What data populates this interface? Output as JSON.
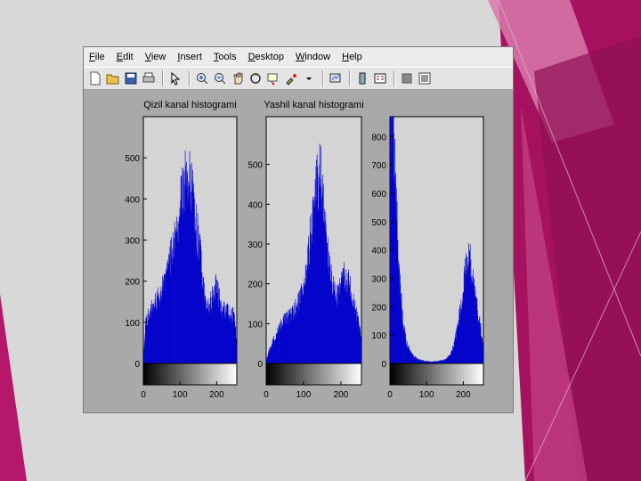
{
  "window": {
    "menu": [
      "File",
      "Edit",
      "View",
      "Insert",
      "Tools",
      "Desktop",
      "Window",
      "Help"
    ],
    "toolbar_icons": [
      "new-file-icon",
      "open-folder-icon",
      "save-icon",
      "print-icon",
      "sep",
      "pointer-icon",
      "sep",
      "zoom-in-icon",
      "zoom-out-icon",
      "pan-icon",
      "rotate-icon",
      "data-cursor-icon",
      "brush-icon",
      "dropdown-arrow-icon",
      "sep",
      "link-icon",
      "sep",
      "colorbar-icon",
      "legend-icon",
      "sep",
      "hide-tools-icon",
      "show-tools-icon"
    ]
  },
  "colors": {
    "bar": "#0000cc",
    "axes_bg": "#d4d4d4",
    "figure_bg": "#a9a9a9",
    "magenta": "#a6125f"
  },
  "chart_data": [
    {
      "type": "bar",
      "title": "Qizil kanal histogrami",
      "x_range": [
        0,
        255
      ],
      "ylim": [
        0,
        600
      ],
      "yticks": [
        0,
        100,
        200,
        300,
        400,
        500
      ],
      "xticks": [
        0,
        100,
        200
      ],
      "profile": [
        [
          0,
          15
        ],
        [
          5,
          100
        ],
        [
          15,
          120
        ],
        [
          30,
          145
        ],
        [
          45,
          170
        ],
        [
          60,
          200
        ],
        [
          75,
          260
        ],
        [
          90,
          320
        ],
        [
          100,
          380
        ],
        [
          110,
          440
        ],
        [
          118,
          480
        ],
        [
          125,
          450
        ],
        [
          135,
          400
        ],
        [
          145,
          330
        ],
        [
          155,
          270
        ],
        [
          165,
          180
        ],
        [
          175,
          140
        ],
        [
          185,
          155
        ],
        [
          195,
          185
        ],
        [
          200,
          205
        ],
        [
          205,
          170
        ],
        [
          215,
          125
        ],
        [
          225,
          135
        ],
        [
          240,
          120
        ],
        [
          250,
          110
        ],
        [
          255,
          45
        ]
      ]
    },
    {
      "type": "bar",
      "title": "Yashil kanal histogrami",
      "x_range": [
        0,
        255
      ],
      "ylim": [
        0,
        620
      ],
      "yticks": [
        0,
        100,
        200,
        300,
        400,
        500
      ],
      "xticks": [
        0,
        100,
        200
      ],
      "profile": [
        [
          0,
          10
        ],
        [
          10,
          40
        ],
        [
          25,
          70
        ],
        [
          40,
          100
        ],
        [
          55,
          115
        ],
        [
          70,
          130
        ],
        [
          85,
          150
        ],
        [
          100,
          190
        ],
        [
          110,
          250
        ],
        [
          120,
          340
        ],
        [
          128,
          420
        ],
        [
          138,
          460
        ],
        [
          145,
          480
        ],
        [
          150,
          450
        ],
        [
          160,
          380
        ],
        [
          168,
          250
        ],
        [
          178,
          190
        ],
        [
          188,
          170
        ],
        [
          198,
          195
        ],
        [
          205,
          240
        ],
        [
          212,
          215
        ],
        [
          222,
          200
        ],
        [
          235,
          150
        ],
        [
          248,
          115
        ],
        [
          255,
          60
        ]
      ]
    },
    {
      "type": "bar",
      "title": "",
      "x_range": [
        0,
        255
      ],
      "ylim": [
        0,
        870
      ],
      "yticks": [
        0,
        100,
        200,
        300,
        400,
        500,
        600,
        700,
        800
      ],
      "xticks": [
        0,
        100,
        200
      ],
      "profile": [
        [
          0,
          870
        ],
        [
          8,
          870
        ],
        [
          14,
          700
        ],
        [
          20,
          480
        ],
        [
          26,
          290
        ],
        [
          34,
          160
        ],
        [
          45,
          70
        ],
        [
          58,
          35
        ],
        [
          72,
          18
        ],
        [
          90,
          10
        ],
        [
          110,
          6
        ],
        [
          130,
          8
        ],
        [
          150,
          14
        ],
        [
          165,
          30
        ],
        [
          175,
          70
        ],
        [
          185,
          140
        ],
        [
          195,
          220
        ],
        [
          203,
          300
        ],
        [
          210,
          360
        ],
        [
          215,
          390
        ],
        [
          222,
          340
        ],
        [
          230,
          260
        ],
        [
          240,
          180
        ],
        [
          250,
          110
        ],
        [
          255,
          50
        ]
      ]
    }
  ]
}
